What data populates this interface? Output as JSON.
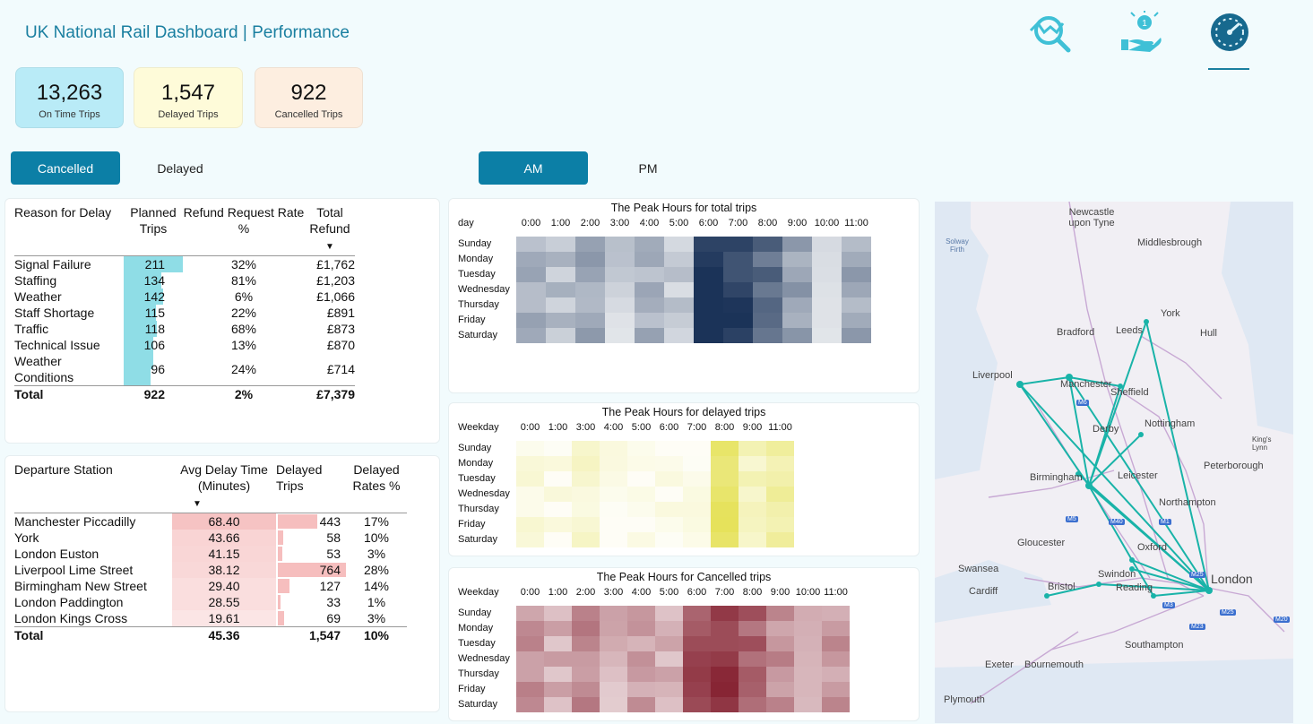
{
  "header": {
    "title": "UK National Rail Dashboard | Performance"
  },
  "nav": [
    {
      "name": "trend-search-icon"
    },
    {
      "name": "refund-hand-icon",
      "badge": "1"
    },
    {
      "name": "speedometer-icon",
      "active": true
    }
  ],
  "kpis": [
    {
      "value": "13,263",
      "label": "On Time Trips",
      "color": "#b9ebf7"
    },
    {
      "value": "1,547",
      "label": "Delayed Trips",
      "color": "#fefbd9"
    },
    {
      "value": "922",
      "label": "Cancelled Trips",
      "color": "#fdeee0"
    }
  ],
  "status_tabs": {
    "cancelled": "Cancelled",
    "delayed": "Delayed"
  },
  "time_tabs": {
    "am": "AM",
    "pm": "PM"
  },
  "reasons_table": {
    "headers": [
      "Reason for Delay",
      "Planned Trips",
      "Refund Request Rate %",
      "Total Refund"
    ],
    "rows": [
      {
        "reason": "Signal Failure",
        "trips": 211,
        "rate": "32%",
        "refund": "£1,762"
      },
      {
        "reason": "Staffing",
        "trips": 134,
        "rate": "81%",
        "refund": "£1,203"
      },
      {
        "reason": "Weather",
        "trips": 142,
        "rate": "6%",
        "refund": "£1,066"
      },
      {
        "reason": "Staff Shortage",
        "trips": 115,
        "rate": "22%",
        "refund": "£891"
      },
      {
        "reason": "Traffic",
        "trips": 118,
        "rate": "68%",
        "refund": "£873"
      },
      {
        "reason": "Technical Issue",
        "trips": 106,
        "rate": "13%",
        "refund": "£870"
      },
      {
        "reason": "Weather Conditions",
        "trips": 96,
        "rate": "24%",
        "refund": "£714"
      }
    ],
    "total": {
      "label": "Total",
      "trips": "922",
      "rate": "2%",
      "refund": "£7,379"
    }
  },
  "stations_table": {
    "headers": [
      "Departure Station",
      "Avg Delay Time (Minutes)",
      "Delayed Trips",
      "Delayed Rates %"
    ],
    "rows": [
      {
        "station": "Manchester Piccadilly",
        "avg": "68.40",
        "trips": 443,
        "rate": "17%"
      },
      {
        "station": "York",
        "avg": "43.66",
        "trips": 58,
        "rate": "10%"
      },
      {
        "station": "London Euston",
        "avg": "41.15",
        "trips": 53,
        "rate": "3%"
      },
      {
        "station": "Liverpool Lime Street",
        "avg": "38.12",
        "trips": 764,
        "rate": "28%"
      },
      {
        "station": "Birmingham New Street",
        "avg": "29.40",
        "trips": 127,
        "rate": "14%"
      },
      {
        "station": "London Paddington",
        "avg": "28.55",
        "trips": 33,
        "rate": "1%"
      },
      {
        "station": "London Kings Cross",
        "avg": "19.61",
        "trips": 69,
        "rate": "3%"
      }
    ],
    "total": {
      "label": "Total",
      "avg": "45.36",
      "trips": "1,547",
      "rate": "10%"
    }
  },
  "heatmaps": {
    "total": {
      "title": "The Peak Hours for total trips",
      "row_header": "day",
      "cols": [
        "0:00",
        "1:00",
        "2:00",
        "3:00",
        "4:00",
        "5:00",
        "6:00",
        "7:00",
        "8:00",
        "9:00",
        "10:00",
        "11:00"
      ],
      "rows": [
        "Sunday",
        "Monday",
        "Tuesday",
        "Wednesday",
        "Thursday",
        "Friday",
        "Saturday"
      ],
      "color": "#1b3358",
      "intensity": [
        0.38,
        0.3,
        0.42,
        0.22,
        0.38,
        0.26,
        1.0,
        0.92,
        0.72,
        0.45,
        0.22,
        0.42
      ]
    },
    "delayed": {
      "title": "The Peak Hours for delayed trips",
      "row_header": "Weekday",
      "cols": [
        "0:00",
        "1:00",
        "3:00",
        "4:00",
        "5:00",
        "6:00",
        "7:00",
        "8:00",
        "9:00",
        "11:00"
      ],
      "rows": [
        "Sunday",
        "Monday",
        "Tuesday",
        "Wednesday",
        "Thursday",
        "Friday",
        "Saturday"
      ],
      "color": "#e4e04f",
      "intensity": [
        0.18,
        0.12,
        0.25,
        0.1,
        0.08,
        0.12,
        0.1,
        0.85,
        0.35,
        0.5
      ]
    },
    "cancelled": {
      "title": "The Peak Hours for Cancelled trips",
      "row_header": "Weekday",
      "cols": [
        "0:00",
        "1:00",
        "2:00",
        "3:00",
        "4:00",
        "5:00",
        "6:00",
        "7:00",
        "8:00",
        "9:00",
        "10:00",
        "11:00"
      ],
      "rows": [
        "Sunday",
        "Monday",
        "Tuesday",
        "Wednesday",
        "Thursday",
        "Friday",
        "Saturday"
      ],
      "color": "#7a0d1e",
      "intensity": [
        0.45,
        0.32,
        0.48,
        0.3,
        0.4,
        0.32,
        0.72,
        0.82,
        0.65,
        0.45,
        0.38,
        0.42
      ]
    }
  },
  "map": {
    "labels": [
      "Newcastle upon Tyne",
      "Middlesbrough",
      "Solway Firth",
      "York",
      "Hull",
      "Bradford",
      "Leeds",
      "Liverpool",
      "Manchester",
      "Sheffield",
      "Nottingham",
      "Derby",
      "King's Lynn",
      "Peterborough",
      "Birmingham",
      "Leicester",
      "Northampton",
      "Gloucester",
      "Oxford",
      "Swansea",
      "Swindon",
      "Cardiff",
      "Bristol",
      "Reading",
      "London",
      "Southampton",
      "Exeter",
      "Bournemouth",
      "Plymouth"
    ],
    "shields": [
      "M6",
      "M5",
      "M40",
      "M1",
      "M25",
      "M3",
      "M25",
      "M23",
      "M20"
    ]
  }
}
